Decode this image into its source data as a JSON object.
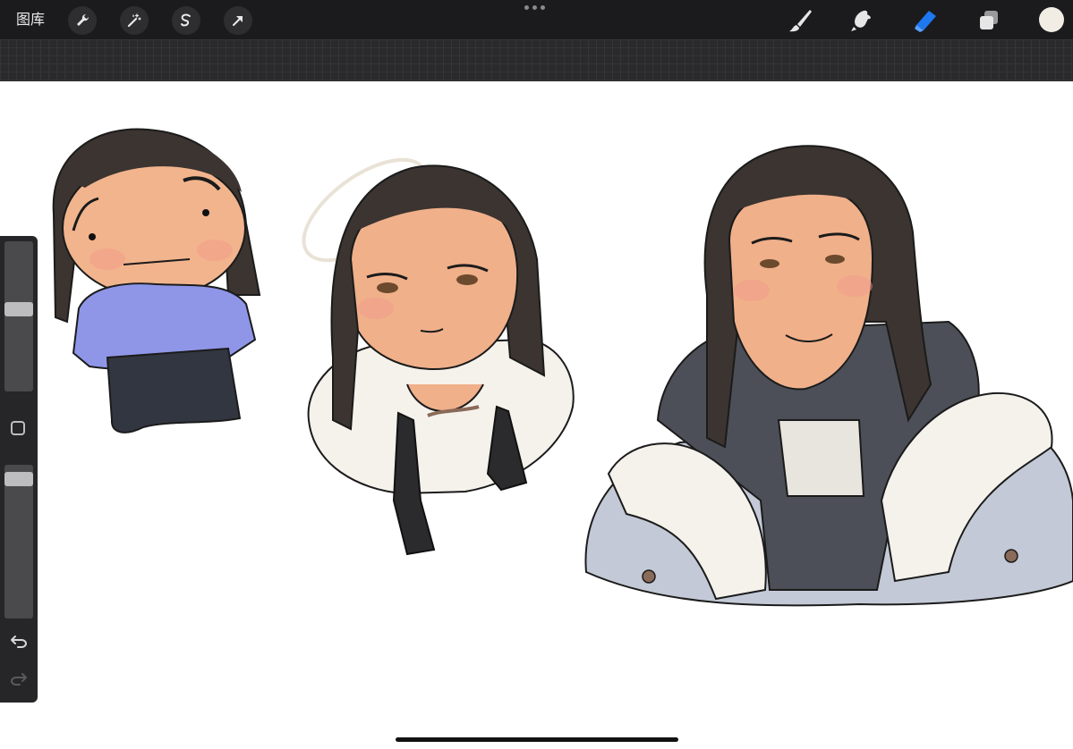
{
  "toolbar": {
    "gallery_label": "图库",
    "left_tools": [
      "wrench-icon",
      "magic-wand-icon",
      "selection-icon",
      "transform-arrow-icon"
    ],
    "right_tools": [
      "brush-icon",
      "smudge-icon",
      "eraser-icon",
      "layers-icon"
    ],
    "active_tool": "eraser",
    "accent_color": "#1e78f0",
    "current_color": "#f2ede4"
  },
  "sidebar": {
    "brush_size_level": 0.55,
    "opacity_level": 0.95
  },
  "canvas": {
    "figures": [
      "chibi-figure",
      "shirt-tie-figure",
      "hoodie-jacket-figure"
    ]
  }
}
